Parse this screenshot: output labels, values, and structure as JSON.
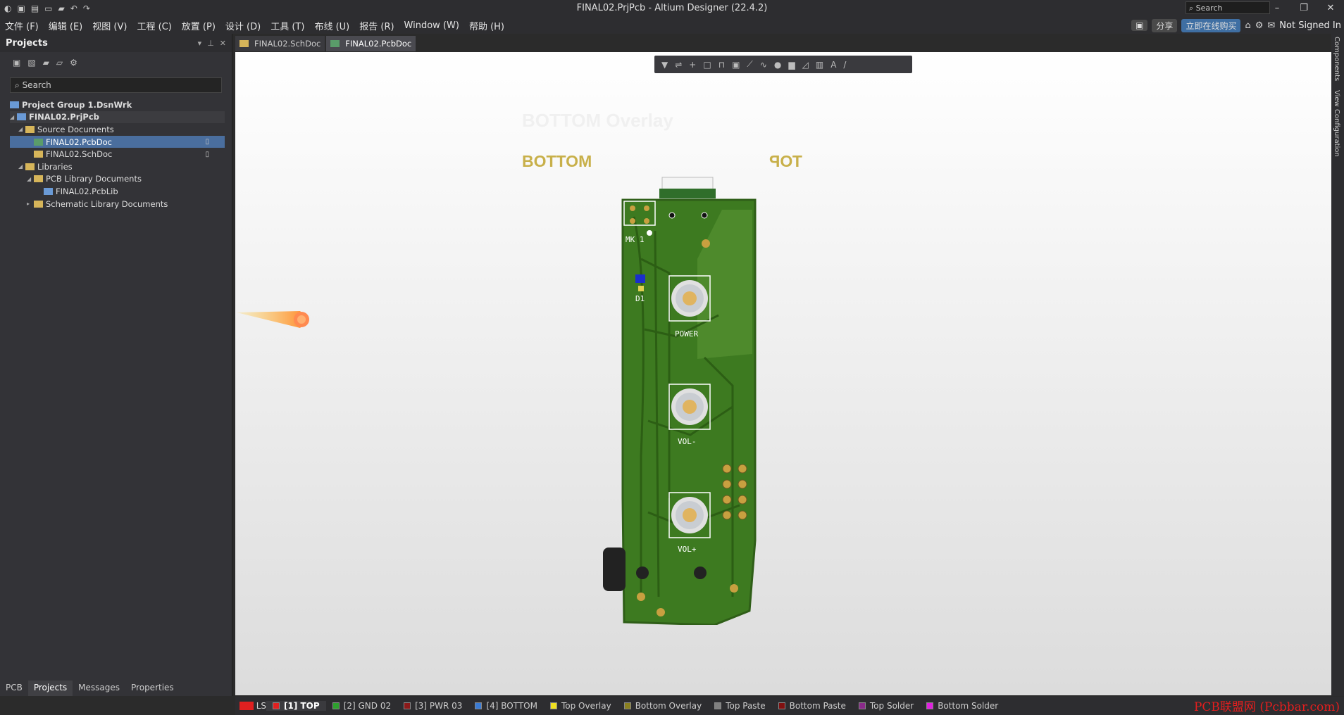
{
  "window": {
    "title": "FINAL02.PrjPcb - Altium Designer (22.4.2)",
    "search_label": "Search"
  },
  "menu": [
    "文件 (F)",
    "编辑 (E)",
    "视图 (V)",
    "工程 (C)",
    "放置 (P)",
    "设计 (D)",
    "工具 (T)",
    "布线 (U)",
    "报告 (R)",
    "Window (W)",
    "帮助 (H)"
  ],
  "menu_right": {
    "share": "分享",
    "buy": "立即在线购买",
    "user": "Not Signed In"
  },
  "projects_panel": {
    "title": "Projects",
    "search_placeholder": "Search",
    "tree": [
      {
        "label": "Project Group 1.DsnWrk"
      },
      {
        "label": "FINAL02.PrjPcb"
      },
      {
        "label": "Source Documents"
      },
      {
        "label": "FINAL02.PcbDoc"
      },
      {
        "label": "FINAL02.SchDoc"
      },
      {
        "label": "Libraries"
      },
      {
        "label": "PCB Library Documents"
      },
      {
        "label": "FINAL02.PcbLib"
      },
      {
        "label": "Schematic Library Documents"
      }
    ]
  },
  "bottom_tabs": [
    "PCB",
    "Projects",
    "Messages",
    "Properties"
  ],
  "doc_tabs": [
    "FINAL02.SchDoc",
    "FINAL02.PcbDoc"
  ],
  "right_tabs": [
    "Components",
    "View Configuration"
  ],
  "canvas": {
    "label_bottom": "BOTTOM",
    "label_top": "TOP",
    "ghost_text": "BOTTOM Overlay",
    "components": [
      "MK 1",
      "D1",
      "POWER",
      "VOL-",
      "VOL+"
    ]
  },
  "layers": [
    {
      "name": "LS",
      "color": "#e02020"
    },
    {
      "name": "[1] TOP",
      "color": "#e02020"
    },
    {
      "name": "[2] GND 02",
      "color": "#2ea02e"
    },
    {
      "name": "[3] PWR 03",
      "color": "#8b1a1a"
    },
    {
      "name": "[4] BOTTOM",
      "color": "#3a7bd5"
    },
    {
      "name": "Top Overlay",
      "color": "#f0e020"
    },
    {
      "name": "Bottom Overlay",
      "color": "#8a8020"
    },
    {
      "name": "Top Paste",
      "color": "#808080"
    },
    {
      "name": "Bottom Paste",
      "color": "#801010"
    },
    {
      "name": "Top Solder",
      "color": "#8a2a8a"
    },
    {
      "name": "Bottom Solder",
      "color": "#e020e0"
    }
  ],
  "watermark": "PCB联盟网 (Pcbbar.com)"
}
